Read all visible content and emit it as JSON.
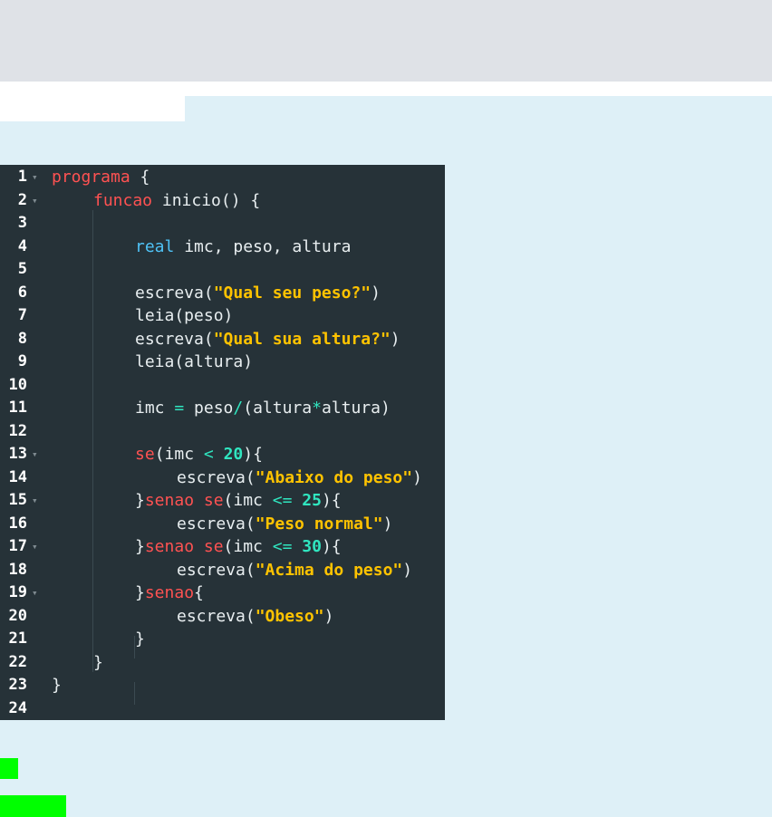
{
  "editor": {
    "lines": [
      {
        "n": "1",
        "fold": true,
        "indent": 0,
        "tokens": [
          {
            "t": "programa",
            "c": "kw"
          },
          {
            "t": " {",
            "c": "tx"
          }
        ]
      },
      {
        "n": "2",
        "fold": true,
        "indent": 1,
        "tokens": [
          {
            "t": "funcao",
            "c": "kw"
          },
          {
            "t": " inicio() {",
            "c": "tx"
          }
        ]
      },
      {
        "n": "3",
        "fold": false,
        "indent": 0,
        "tokens": []
      },
      {
        "n": "4",
        "fold": false,
        "indent": 2,
        "tokens": [
          {
            "t": "real",
            "c": "ty"
          },
          {
            "t": " imc, peso, altura",
            "c": "tx"
          }
        ]
      },
      {
        "n": "5",
        "fold": false,
        "indent": 0,
        "tokens": []
      },
      {
        "n": "6",
        "fold": false,
        "indent": 2,
        "tokens": [
          {
            "t": "escreva(",
            "c": "tx"
          },
          {
            "t": "\"Qual seu peso?\"",
            "c": "st"
          },
          {
            "t": ")",
            "c": "tx"
          }
        ]
      },
      {
        "n": "7",
        "fold": false,
        "indent": 2,
        "tokens": [
          {
            "t": "leia(peso)",
            "c": "tx"
          }
        ]
      },
      {
        "n": "8",
        "fold": false,
        "indent": 2,
        "tokens": [
          {
            "t": "escreva(",
            "c": "tx"
          },
          {
            "t": "\"Qual sua altura?\"",
            "c": "st"
          },
          {
            "t": ")",
            "c": "tx"
          }
        ]
      },
      {
        "n": "9",
        "fold": false,
        "indent": 2,
        "tokens": [
          {
            "t": "leia(altura)",
            "c": "tx"
          }
        ]
      },
      {
        "n": "10",
        "fold": false,
        "indent": 0,
        "tokens": []
      },
      {
        "n": "11",
        "fold": false,
        "indent": 2,
        "tokens": [
          {
            "t": "imc ",
            "c": "tx"
          },
          {
            "t": "=",
            "c": "op"
          },
          {
            "t": " peso",
            "c": "tx"
          },
          {
            "t": "/",
            "c": "op"
          },
          {
            "t": "(altura",
            "c": "tx"
          },
          {
            "t": "*",
            "c": "op"
          },
          {
            "t": "altura)",
            "c": "tx"
          }
        ]
      },
      {
        "n": "12",
        "fold": false,
        "indent": 0,
        "tokens": []
      },
      {
        "n": "13",
        "fold": true,
        "indent": 2,
        "tokens": [
          {
            "t": "se",
            "c": "kw"
          },
          {
            "t": "(imc ",
            "c": "tx"
          },
          {
            "t": "<",
            "c": "op"
          },
          {
            "t": " ",
            "c": "tx"
          },
          {
            "t": "20",
            "c": "nm"
          },
          {
            "t": "){",
            "c": "tx"
          }
        ]
      },
      {
        "n": "14",
        "fold": false,
        "indent": 3,
        "tokens": [
          {
            "t": "escreva(",
            "c": "tx"
          },
          {
            "t": "\"Abaixo do peso\"",
            "c": "st"
          },
          {
            "t": ")",
            "c": "tx"
          }
        ]
      },
      {
        "n": "15",
        "fold": true,
        "indent": 2,
        "tokens": [
          {
            "t": "}",
            "c": "tx"
          },
          {
            "t": "senao se",
            "c": "kw"
          },
          {
            "t": "(imc ",
            "c": "tx"
          },
          {
            "t": "<=",
            "c": "op"
          },
          {
            "t": " ",
            "c": "tx"
          },
          {
            "t": "25",
            "c": "nm"
          },
          {
            "t": "){",
            "c": "tx"
          }
        ]
      },
      {
        "n": "16",
        "fold": false,
        "indent": 3,
        "tokens": [
          {
            "t": "escreva(",
            "c": "tx"
          },
          {
            "t": "\"Peso normal\"",
            "c": "st"
          },
          {
            "t": ")",
            "c": "tx"
          }
        ]
      },
      {
        "n": "17",
        "fold": true,
        "indent": 2,
        "tokens": [
          {
            "t": "}",
            "c": "tx"
          },
          {
            "t": "senao se",
            "c": "kw"
          },
          {
            "t": "(imc ",
            "c": "tx"
          },
          {
            "t": "<=",
            "c": "op"
          },
          {
            "t": " ",
            "c": "tx"
          },
          {
            "t": "30",
            "c": "nm"
          },
          {
            "t": "){",
            "c": "tx"
          }
        ]
      },
      {
        "n": "18",
        "fold": false,
        "indent": 3,
        "tokens": [
          {
            "t": "escreva(",
            "c": "tx"
          },
          {
            "t": "\"Acima do peso\"",
            "c": "st"
          },
          {
            "t": ")",
            "c": "tx"
          }
        ]
      },
      {
        "n": "19",
        "fold": true,
        "indent": 2,
        "tokens": [
          {
            "t": "}",
            "c": "tx"
          },
          {
            "t": "senao",
            "c": "kw"
          },
          {
            "t": "{",
            "c": "tx"
          }
        ]
      },
      {
        "n": "20",
        "fold": false,
        "indent": 3,
        "tokens": [
          {
            "t": "escreva(",
            "c": "tx"
          },
          {
            "t": "\"Obeso\"",
            "c": "st"
          },
          {
            "t": ")",
            "c": "tx"
          }
        ]
      },
      {
        "n": "21",
        "fold": false,
        "indent": 2,
        "tokens": [
          {
            "t": "}",
            "c": "tx"
          }
        ]
      },
      {
        "n": "22",
        "fold": false,
        "indent": 1,
        "tokens": [
          {
            "t": "}",
            "c": "tx"
          }
        ]
      },
      {
        "n": "23",
        "fold": false,
        "indent": 0,
        "tokens": [
          {
            "t": "}",
            "c": "tx"
          }
        ]
      },
      {
        "n": "24",
        "fold": false,
        "indent": 0,
        "tokens": []
      }
    ],
    "fold_icon": "caret-down-icon",
    "colors": {
      "background": "#263238",
      "keyword": "#ff5252",
      "type": "#4fc3f7",
      "string": "#ffc300",
      "number": "#30e6c0",
      "text": "#e8eef0"
    }
  },
  "highlights": {
    "color": "#00ff00"
  }
}
